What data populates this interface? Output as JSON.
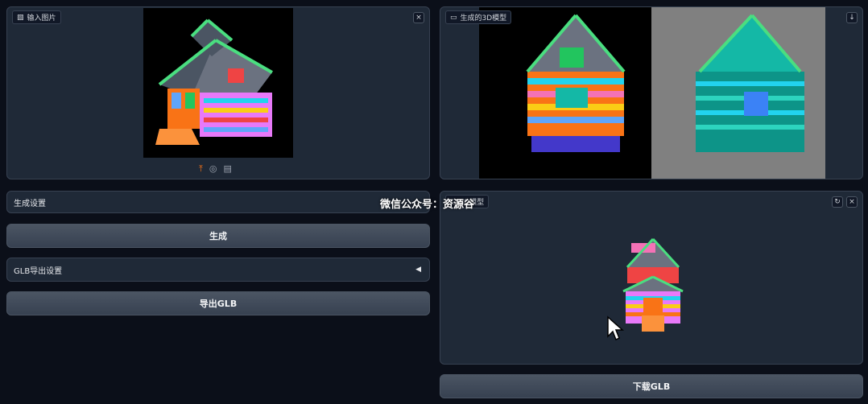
{
  "input_panel": {
    "label": "输入图片",
    "close": "×"
  },
  "generated_panel": {
    "label": "生成的3D模型",
    "download": "↓"
  },
  "settings": {
    "label": "生成设置"
  },
  "generate_button": "生成",
  "glb_settings": {
    "label": "GLB导出设置",
    "toggle": "◀"
  },
  "export_button": "导出GLB",
  "watermark": "微信公众号：资源谷",
  "viewer_panel": {
    "label": "3D模型",
    "reset": "↻",
    "close": "×"
  },
  "download_button": "下载GLB"
}
